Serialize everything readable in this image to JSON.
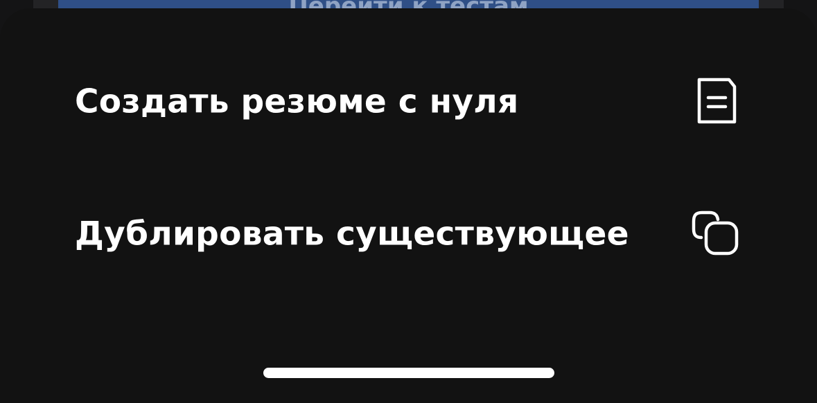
{
  "backdrop": {
    "button_label": "Перейти к тестам"
  },
  "sheet": {
    "items": [
      {
        "label": "Создать резюме с нуля",
        "icon": "document-icon"
      },
      {
        "label": "Дублировать существующее",
        "icon": "duplicate-icon"
      }
    ]
  },
  "colors": {
    "sheet_background": "#121212",
    "text": "#ffffff",
    "backdrop_button": "#2f4f86"
  }
}
